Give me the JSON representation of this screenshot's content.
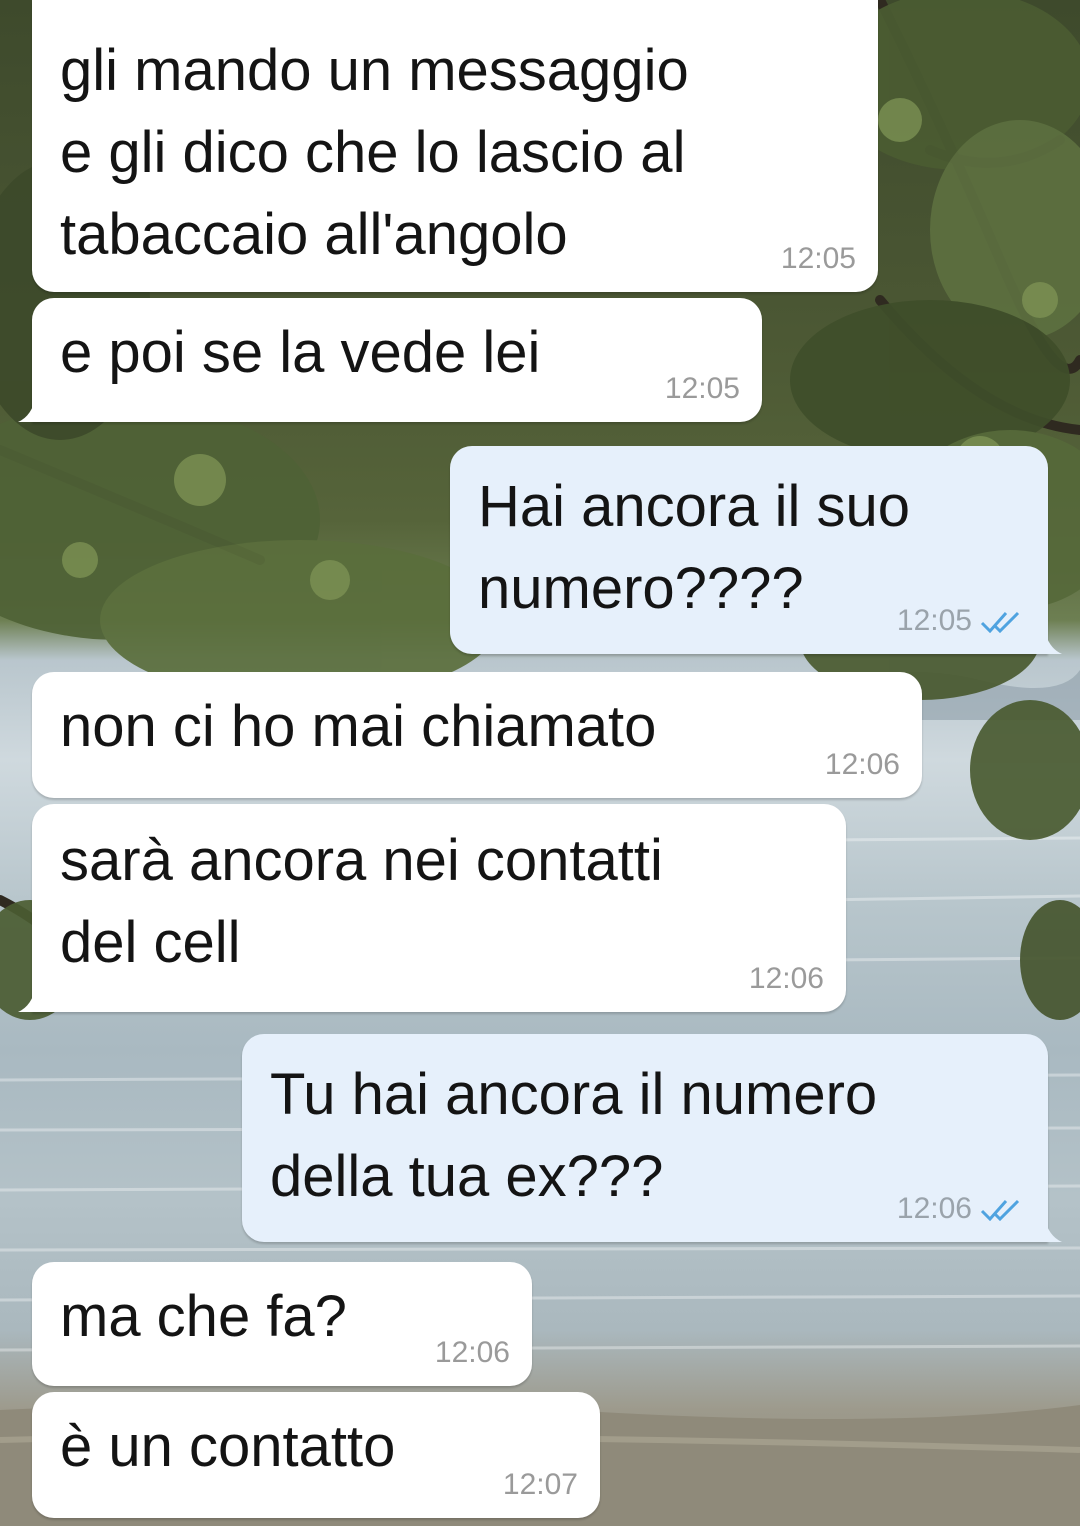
{
  "colors": {
    "incoming_bubble": "#ffffff",
    "outgoing_bubble": "#e6f0fb",
    "read_ticks": "#4fa3e0",
    "timestamp": "#9a9a9a"
  },
  "messages": [
    {
      "direction": "incoming",
      "text": "gli mando un messaggio\ne gli dico che lo lascio al\ntabaccaio all'angolo",
      "time": "12:05"
    },
    {
      "direction": "incoming",
      "text": "e poi se la vede lei",
      "time": "12:05"
    },
    {
      "direction": "outgoing",
      "text": "Hai ancora il suo\nnumero????",
      "time": "12:05",
      "status_icon": "double-check-read-icon"
    },
    {
      "direction": "incoming",
      "text": "non ci ho mai chiamato",
      "time": "12:06"
    },
    {
      "direction": "incoming",
      "text": "sarà ancora nei contatti\ndel cell",
      "time": "12:06"
    },
    {
      "direction": "outgoing",
      "text": "Tu hai ancora il numero\ndella tua ex???",
      "time": "12:06",
      "status_icon": "double-check-read-icon"
    },
    {
      "direction": "incoming",
      "text": "ma che fa?",
      "time": "12:06"
    },
    {
      "direction": "incoming",
      "text": "è un contatto",
      "time": "12:07"
    }
  ]
}
